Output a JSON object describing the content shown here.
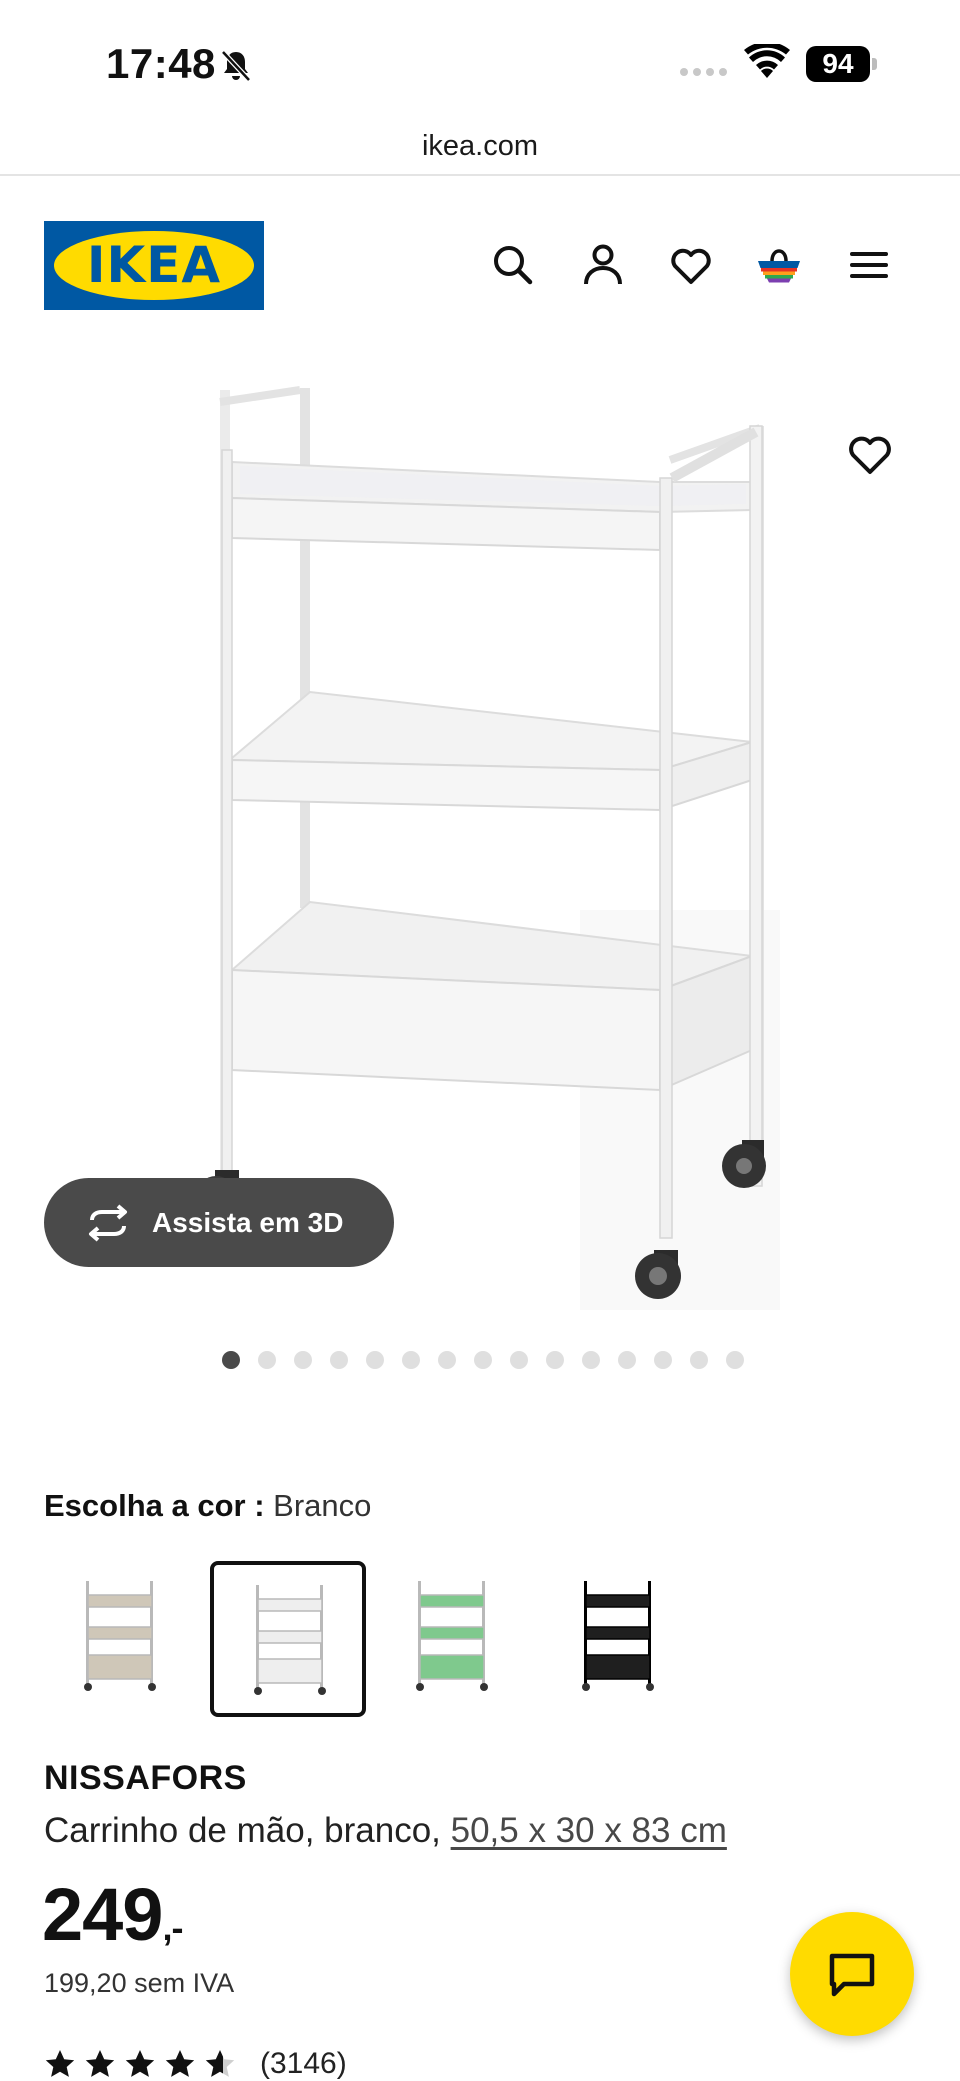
{
  "status_bar": {
    "time": "17:48",
    "battery": "94",
    "icons": [
      "bell-slash-icon",
      "signal-icon",
      "wifi-icon",
      "battery-icon"
    ]
  },
  "browser": {
    "url": "ikea.com"
  },
  "header": {
    "logo_text": "IKEA",
    "icons": [
      "search-icon",
      "account-icon",
      "wishlist-icon",
      "basket-icon",
      "menu-icon"
    ],
    "brand_colors": {
      "blue": "#0058a3",
      "yellow": "#ffdb00"
    }
  },
  "gallery": {
    "view_3d_label": "Assista em 3D",
    "image_count": 15,
    "active_index": 0
  },
  "color_selector": {
    "label": "Escolha a cor :",
    "selected": "Branco",
    "swatches": [
      {
        "color": "#cfc7b8",
        "selected": false
      },
      {
        "color": "#eeeeee",
        "selected": true
      },
      {
        "color": "#7fc98d",
        "selected": false
      },
      {
        "color": "#1f1f1f",
        "selected": false
      }
    ]
  },
  "product": {
    "name": "NISSAFORS",
    "description": "Carrinho de mão, branco, ",
    "dimensions": "50,5 x 30 x 83 cm",
    "price": "249",
    "price_suffix": ",-",
    "price_without_vat": "199,20 sem IVA",
    "rating": 4.6,
    "rating_count": "(3146)"
  },
  "chat": {
    "icon": "chat-icon",
    "accent": "#ffdb00"
  }
}
